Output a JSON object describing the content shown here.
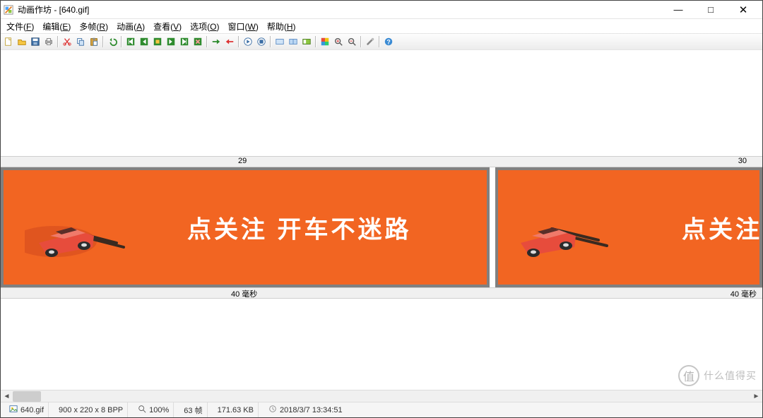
{
  "title": "动画作坊 - [640.gif]",
  "menu": {
    "file": {
      "label": "文件",
      "hot": "F"
    },
    "edit": {
      "label": "编辑",
      "hot": "E"
    },
    "frames": {
      "label": "多帧",
      "hot": "R"
    },
    "anim": {
      "label": "动画",
      "hot": "A"
    },
    "view": {
      "label": "查看",
      "hot": "V"
    },
    "options": {
      "label": "选项",
      "hot": "O"
    },
    "window": {
      "label": "窗口",
      "hot": "W"
    },
    "help": {
      "label": "帮助",
      "hot": "H"
    }
  },
  "frames": {
    "a": {
      "index": "29",
      "delay": "40 毫秒",
      "caption": "点关注 开车不迷路"
    },
    "b": {
      "index": "30",
      "delay": "40 毫秒",
      "caption": "点关注"
    }
  },
  "status": {
    "filename": "640.gif",
    "dimensions": "900 x 220 x 8 BPP",
    "zoom": "100%",
    "framecount": "63 帧",
    "filesize": "171.63 KB",
    "datetime": "2018/3/7 13:34:51"
  },
  "watermark": {
    "badge": "值",
    "text": "什么值得买"
  },
  "colors": {
    "accent": "#f26522"
  }
}
